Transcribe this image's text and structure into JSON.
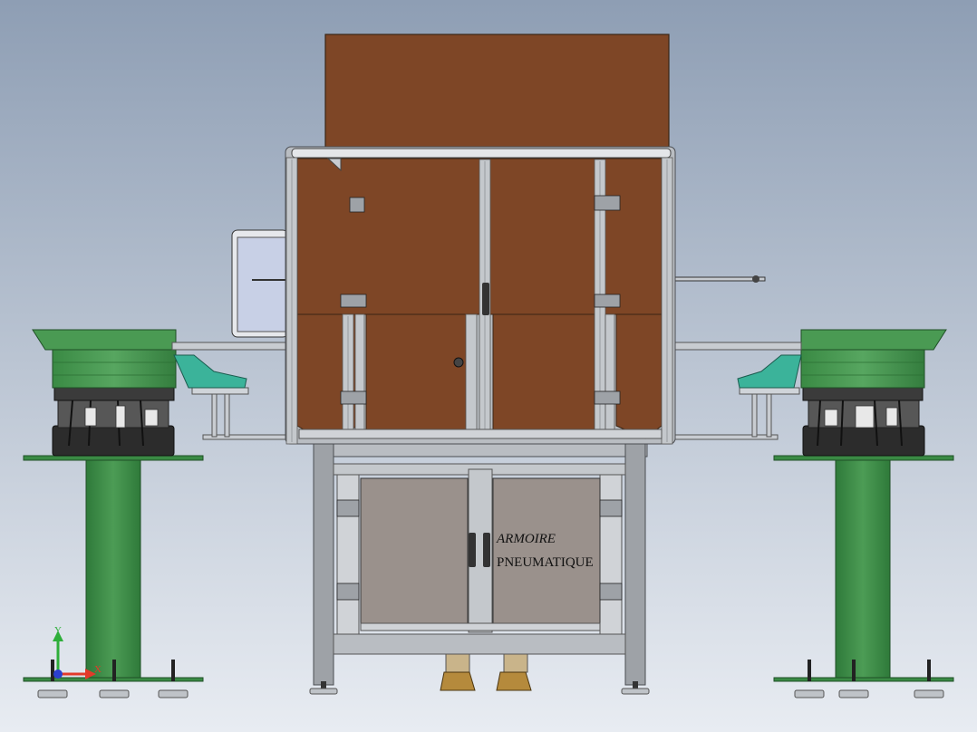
{
  "scene": {
    "background_top": "#8e9eb4",
    "background_bottom": "#e8ecf2",
    "colors": {
      "enclosure_brown": "#7e4626",
      "enclosure_edge": "#3a2414",
      "frame_grey": "#b9bdc2",
      "frame_dark": "#5e6166",
      "cabinet_panel": "#9a918c",
      "bowl_green": "#3f8d48",
      "bowl_green_dark": "#2c6a35",
      "base_black": "#2c2c2c",
      "screen_blue": "#c8d0e6",
      "tray_teal": "#3bb39a",
      "boot_brown": "#b58a3c"
    },
    "cabinet_label": {
      "line1": "ARMOIRE",
      "line2": "PNEUMATIQUE"
    },
    "axis_triad": {
      "y_label": "Y",
      "x_label": "X",
      "y_color": "#2eae3a",
      "x_color": "#e23a2a",
      "origin_color": "#2b3fd0"
    }
  }
}
